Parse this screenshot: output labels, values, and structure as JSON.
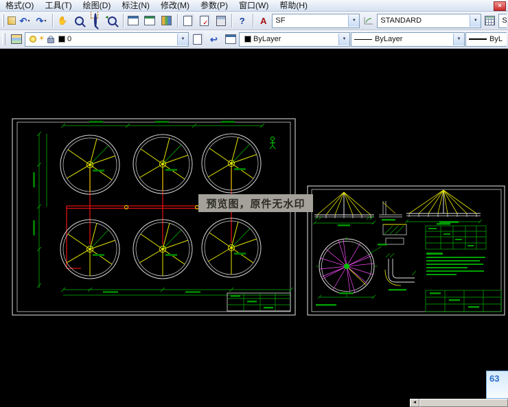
{
  "menu": {
    "items": [
      {
        "label": "格式(O)"
      },
      {
        "label": "工具(T)"
      },
      {
        "label": "绘图(D)"
      },
      {
        "label": "标注(N)"
      },
      {
        "label": "修改(M)"
      },
      {
        "label": "参数(P)"
      },
      {
        "label": "窗口(W)"
      },
      {
        "label": "帮助(H)"
      }
    ]
  },
  "toolbars": {
    "standard": {
      "text_style": "SF",
      "dim_style": "STANDARD",
      "table_style": "Standar"
    },
    "layers": {
      "layer_name": "0",
      "color": "ByLayer",
      "linetype": "ByLayer",
      "lineweight": "ByL"
    }
  },
  "icons": {
    "undo": "↶",
    "redo": "↷",
    "pan": "✋",
    "help": "?",
    "text_style": "A",
    "combo_arrow": "▼",
    "dropdown_caret": "▾",
    "scroll_left": "◄",
    "sun": "☀",
    "close": "×",
    "layer_back": "↩",
    "zoom_prev_arrow": "◂"
  },
  "canvas": {
    "watermark_text": "预览图，原件无水印"
  },
  "popup": {
    "number": "63"
  },
  "colors": {
    "canvas_bg": "#000000",
    "drawing_white": "#e8e8e8",
    "drawing_green": "#00b400",
    "drawing_yellow": "#e8e800",
    "drawing_red": "#dd1111",
    "drawing_magenta": "#ff4dff",
    "watermark_bg": "#a3a199",
    "popup_blue": "#2b6fc9"
  }
}
